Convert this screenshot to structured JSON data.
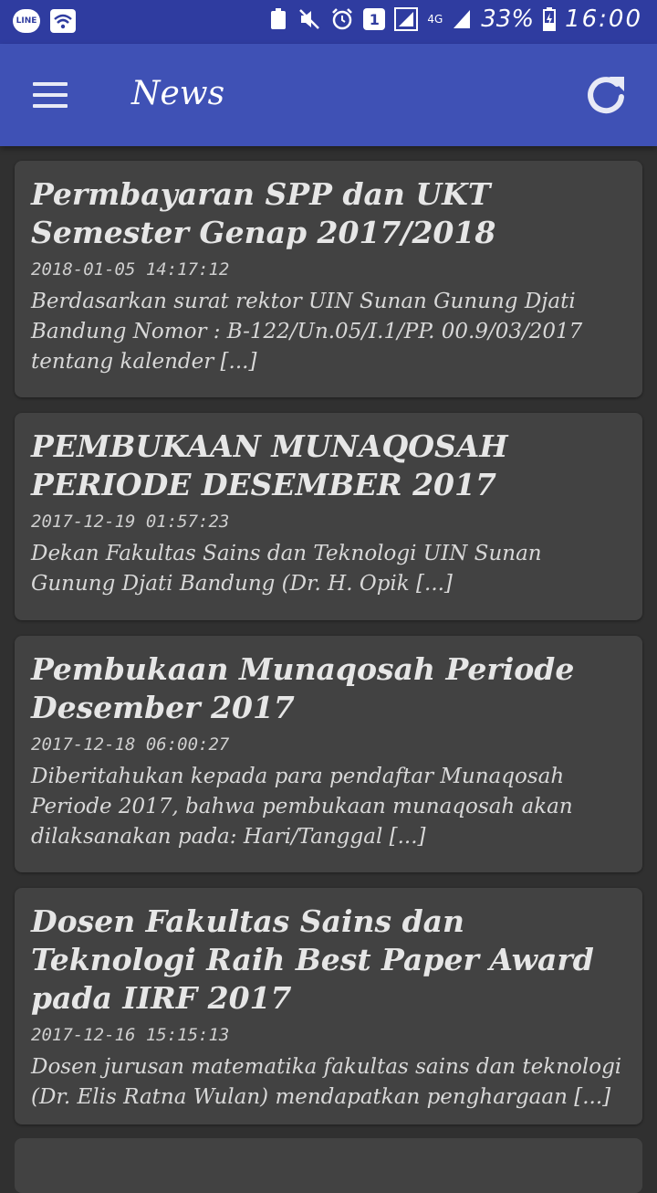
{
  "status_bar": {
    "left_icons": [
      "line-icon",
      "wifi-icon"
    ],
    "line_label": "LINE",
    "sim_label": "1",
    "network_label": "4G",
    "battery_percent": "33%",
    "time": "16:00"
  },
  "app_bar": {
    "title": "News",
    "menu_icon": "hamburger-menu-icon",
    "refresh_icon": "refresh-icon",
    "color": "#3f51b5"
  },
  "news": [
    {
      "title": "Permbayaran SPP dan UKT Semester Genap 2017/2018",
      "date": "2018-01-05 14:17:12",
      "excerpt": "Berdasarkan surat rektor UIN Sunan Gunung Djati Bandung Nomor : B-122/Un.05/I.1/PP. 00.9/03/2017 tentang kalender [...]"
    },
    {
      "title": "PEMBUKAAN MUNAQOSAH PERIODE DESEMBER 2017",
      "date": "2017-12-19 01:57:23",
      "excerpt": "Dekan Fakultas Sains dan Teknologi UIN Sunan Gunung Djati Bandung (Dr. H. Opik [...]"
    },
    {
      "title": "Pembukaan Munaqosah Periode Desember 2017",
      "date": "2017-12-18 06:00:27",
      "excerpt": "Diberitahukan kepada para pendaftar Munaqosah Periode 2017, bahwa pembukaan munaqosah akan dilaksanakan pada: Hari/Tanggal [...]"
    },
    {
      "title": "Dosen Fakultas Sains dan Teknologi Raih Best Paper Award pada IIRF 2017",
      "date": "2017-12-16 15:15:13",
      "excerpt": "Dosen jurusan matematika fakultas sains dan teknologi (Dr. Elis Ratna Wulan) mendapatkan penghargaan [...]"
    }
  ]
}
